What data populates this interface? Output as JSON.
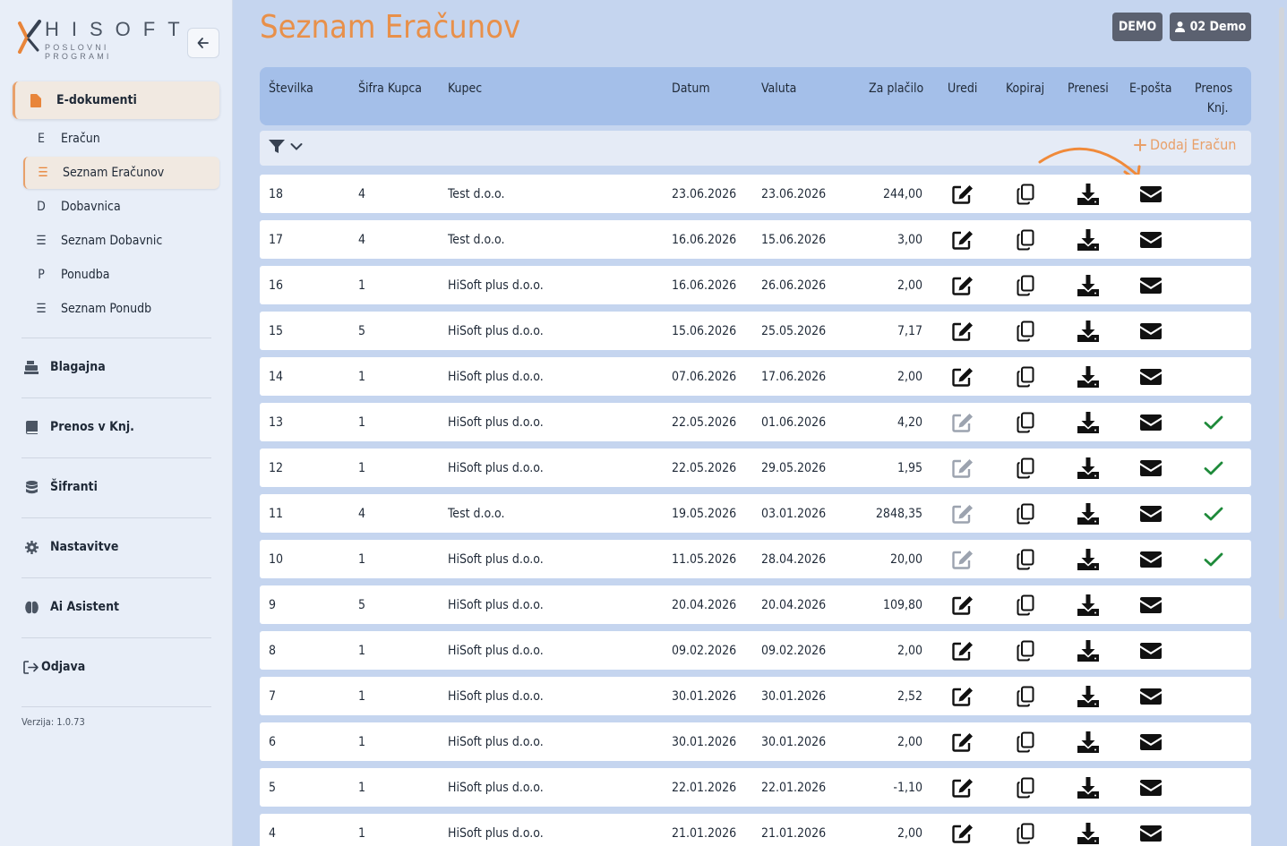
{
  "brand": {
    "name": "HISOFT",
    "subtitle": "POSLOVNI PROGRAMI"
  },
  "sidebar": {
    "group": {
      "label": "E-dokumenti"
    },
    "sub_items": [
      {
        "icon": "E",
        "label": "Eračun"
      },
      {
        "icon": "list",
        "label": "Seznam Eračunov"
      },
      {
        "icon": "D",
        "label": "Dobavnica"
      },
      {
        "icon": "list",
        "label": "Seznam Dobavnic"
      },
      {
        "icon": "P",
        "label": "Ponudba"
      },
      {
        "icon": "list",
        "label": "Seznam Ponudb"
      }
    ],
    "main_items": [
      {
        "icon": "cash-register-icon",
        "label": "Blagajna"
      },
      {
        "icon": "book-icon",
        "label": "Prenos v Knj."
      },
      {
        "icon": "database-icon",
        "label": "Šifranti"
      },
      {
        "icon": "gear-icon",
        "label": "Nastavitve"
      },
      {
        "icon": "brain-icon",
        "label": "Ai Asistent"
      },
      {
        "icon": "logout-icon",
        "label": "Odjava"
      }
    ],
    "version": "Verzija: 1.0.73"
  },
  "header": {
    "title": "Seznam Eračunov",
    "demo_badge": "DEMO",
    "user_label": "02 Demo"
  },
  "table": {
    "columns": {
      "number": "Številka",
      "customer_code": "Šifra Kupca",
      "customer": "Kupec",
      "date": "Datum",
      "currency": "Valuta",
      "amount": "Za plačilo",
      "edit": "Uredi",
      "copy": "Kopiraj",
      "download": "Prenesi",
      "email": "E-pošta",
      "transfer_line1": "Prenos",
      "transfer_line2": "Knj."
    },
    "add_button": "Dodaj Eračun",
    "rows": [
      {
        "number": "18",
        "code": "4",
        "customer": "Test d.o.o.",
        "date": "23.06.2026",
        "currency": "23.06.2026",
        "amount": "244,00",
        "transferred": false
      },
      {
        "number": "17",
        "code": "4",
        "customer": "Test d.o.o.",
        "date": "16.06.2026",
        "currency": "15.06.2026",
        "amount": "3,00",
        "transferred": false
      },
      {
        "number": "16",
        "code": "1",
        "customer": "HiSoft plus d.o.o.",
        "date": "16.06.2026",
        "currency": "26.06.2026",
        "amount": "2,00",
        "transferred": false
      },
      {
        "number": "15",
        "code": "5",
        "customer": "HiSoft plus d.o.o.",
        "date": "15.06.2026",
        "currency": "25.05.2026",
        "amount": "7,17",
        "transferred": false
      },
      {
        "number": "14",
        "code": "1",
        "customer": "HiSoft plus d.o.o.",
        "date": "07.06.2026",
        "currency": "17.06.2026",
        "amount": "2,00",
        "transferred": false
      },
      {
        "number": "13",
        "code": "1",
        "customer": "HiSoft plus d.o.o.",
        "date": "22.05.2026",
        "currency": "01.06.2026",
        "amount": "4,20",
        "transferred": true
      },
      {
        "number": "12",
        "code": "1",
        "customer": "HiSoft plus d.o.o.",
        "date": "22.05.2026",
        "currency": "29.05.2026",
        "amount": "1,95",
        "transferred": true
      },
      {
        "number": "11",
        "code": "4",
        "customer": "Test d.o.o.",
        "date": "19.05.2026",
        "currency": "03.01.2026",
        "amount": "2848,35",
        "transferred": true
      },
      {
        "number": "10",
        "code": "1",
        "customer": "HiSoft plus d.o.o.",
        "date": "11.05.2026",
        "currency": "28.04.2026",
        "amount": "20,00",
        "transferred": true
      },
      {
        "number": "9",
        "code": "5",
        "customer": "HiSoft plus d.o.o.",
        "date": "20.04.2026",
        "currency": "20.04.2026",
        "amount": "109,80",
        "transferred": false
      },
      {
        "number": "8",
        "code": "1",
        "customer": "HiSoft plus d.o.o.",
        "date": "09.02.2026",
        "currency": "09.02.2026",
        "amount": "2,00",
        "transferred": false
      },
      {
        "number": "7",
        "code": "1",
        "customer": "HiSoft plus d.o.o.",
        "date": "30.01.2026",
        "currency": "30.01.2026",
        "amount": "2,52",
        "transferred": false
      },
      {
        "number": "6",
        "code": "1",
        "customer": "HiSoft plus d.o.o.",
        "date": "30.01.2026",
        "currency": "30.01.2026",
        "amount": "2,00",
        "transferred": false
      },
      {
        "number": "5",
        "code": "1",
        "customer": "HiSoft plus d.o.o.",
        "date": "22.01.2026",
        "currency": "22.01.2026",
        "amount": "-1,10",
        "transferred": false
      },
      {
        "number": "4",
        "code": "1",
        "customer": "HiSoft plus d.o.o.",
        "date": "21.01.2026",
        "currency": "21.01.2026",
        "amount": "2,00",
        "transferred": false
      }
    ]
  },
  "colors": {
    "accent": "#e8904a",
    "header_bg": "#a4bfe9",
    "page_bg": "#c5d5ef",
    "check": "#1e8a3a",
    "badge_bg": "#5b6170"
  }
}
